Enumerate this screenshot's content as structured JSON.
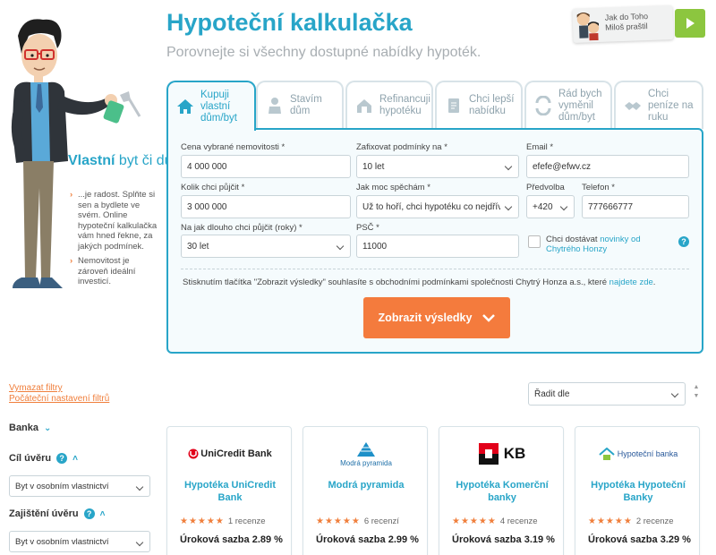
{
  "header": {
    "title": "Hypoteční kalkulačka",
    "subtitle": "Porovnejte si všechny dostupné nabídky hypoték."
  },
  "promo": {
    "line1": "Jak do Toho",
    "line2": "Miloš praštil"
  },
  "hero": {
    "heading_bold": "Vlastní",
    "heading_rest": " byt či dům...",
    "bullets": [
      "...je radost. Splňte si sen a bydlete ve svém. Online hypoteční kalkulačka vám hned řekne, za jakých podmínek.",
      "Nemovitost je zároveň ideální investicí."
    ]
  },
  "tabs": [
    {
      "label": "Kupuji vlastní dům/byt",
      "icon": "house-icon",
      "active": true
    },
    {
      "label": "Stavím dům",
      "icon": "builder-icon",
      "active": false
    },
    {
      "label": "Refinancuji hypotéku",
      "icon": "refinance-house-icon",
      "active": false
    },
    {
      "label": "Chci lepší nabídku",
      "icon": "document-icon",
      "active": false
    },
    {
      "label": "Rád bych vyměnil dům/byt",
      "icon": "exchange-icon",
      "active": false
    },
    {
      "label": "Chci peníze na ruku",
      "icon": "handshake-icon",
      "active": false
    }
  ],
  "form": {
    "price_label": "Cena vybrané nemovitosti *",
    "price_value": "4 000 000",
    "fix_label": "Zafixovat podmínky na *",
    "fix_value": "10 let",
    "email_label": "Email *",
    "email_value": "efefe@efwv.cz",
    "loan_label": "Kolik chci půjčit *",
    "loan_value": "3 000 000",
    "hurry_label": "Jak moc spěchám *",
    "hurry_value": "Už to hoří, chci hypotéku co nejdříve",
    "prefix_label": "Předvolba",
    "prefix_value": "+420",
    "phone_label": "Telefon *",
    "phone_value": "777666777",
    "term_label": "Na jak dlouho chci půjčit (roky) *",
    "term_value": "30 let",
    "zip_label": "PSČ *",
    "zip_value": "11000",
    "newsletter_text": "Chci dostávat ",
    "newsletter_link": "novinky od Chytrého Honzy",
    "help": "?",
    "terms_text": "Stisknutím tlačítka \"Zobrazit výsledky\" souhlasíte s obchodními podmínkami společnosti Chytrý Honza a.s., které ",
    "terms_link": "najdete zde",
    "terms_end": ".",
    "submit_label": "Zobrazit výsledky"
  },
  "filters": {
    "clear": "Vymazat filtry",
    "reset": "Počáteční nastavení filtrů",
    "bank": "Banka",
    "goal": "Cíl úvěru",
    "goal_value": "Byt v osobním vlastnictví",
    "security": "Zajištění úvěru",
    "security_value": "Byt v osobním vlastnictví",
    "sort_placeholder": "Řadit dle"
  },
  "cards": [
    {
      "logo": "UniCredit Bank",
      "name": "Hypotéka UniCredit Bank",
      "stars": "★★★★★",
      "reviews": "1 recenze",
      "rate": "Úroková sazba 2.89 %"
    },
    {
      "logo": "Modrá pyramida",
      "name": "Modrá pyramida",
      "stars": "★★★★★",
      "reviews": "6 recenzí",
      "rate": "Úroková sazba 2.99 %"
    },
    {
      "logo": "KB",
      "name": "Hypotéka Komerční banky",
      "stars": "★★★★★",
      "reviews": "4 recenze",
      "rate": "Úroková sazba 3.19 %"
    },
    {
      "logo": "Hypoteční banka",
      "name": "Hypotéka Hypoteční Banky",
      "stars": "★★★★★",
      "reviews": "2 recenze",
      "rate": "Úroková sazba 3.29 %"
    }
  ],
  "colors": {
    "accent": "#28a5c8",
    "orange": "#f47b3d",
    "green": "#8cc63f"
  }
}
